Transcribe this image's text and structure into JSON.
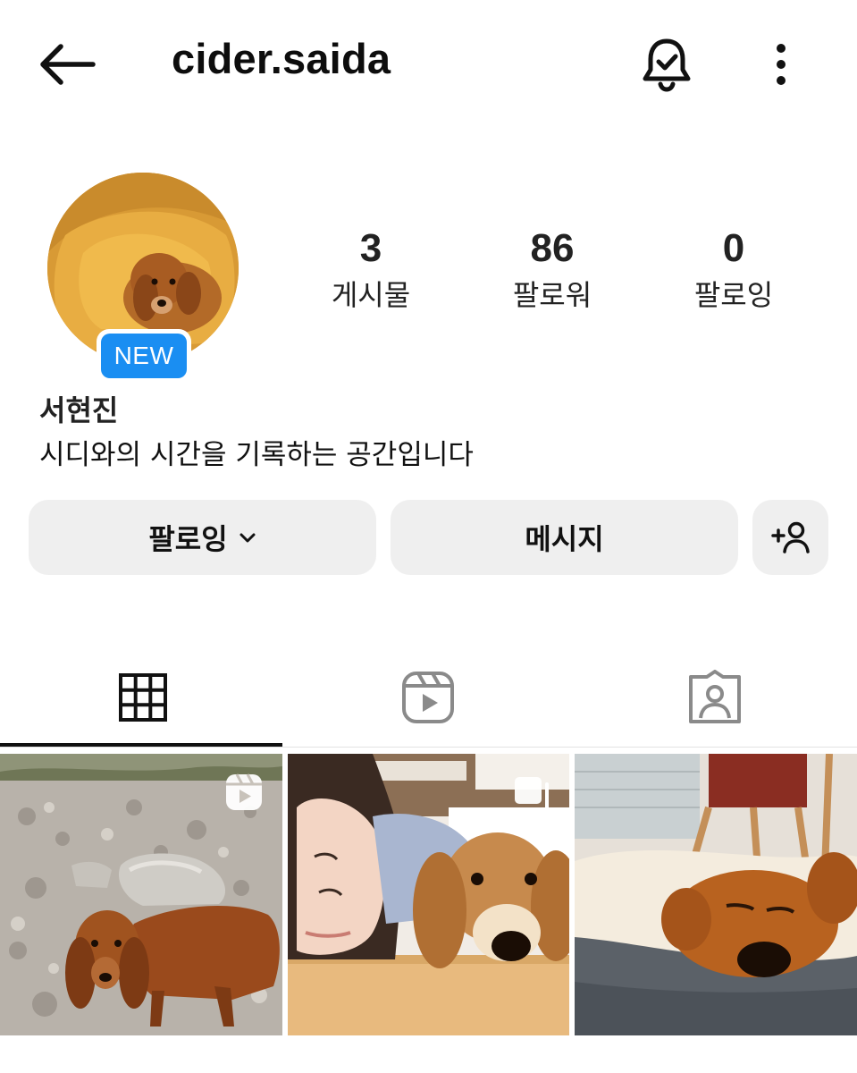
{
  "header": {
    "username": "cider.saida",
    "back_icon": "arrow-left-icon",
    "bell_icon": "bell-check-icon",
    "more_icon": "more-vertical-icon"
  },
  "profile": {
    "avatar": "profile-photo-dog-on-beanbag",
    "badge": "NEW",
    "stats": [
      {
        "value": "3",
        "label": "게시물"
      },
      {
        "value": "86",
        "label": "팔로워"
      },
      {
        "value": "0",
        "label": "팔로잉"
      }
    ],
    "display_name": "서현진",
    "bio": "시디와의 시간을 기록하는 공간입니다"
  },
  "actions": {
    "following_label": "팔로잉",
    "message_label": "메시지",
    "add_user_icon": "add-person-icon"
  },
  "tabs": [
    {
      "icon": "grid-icon",
      "active": true
    },
    {
      "icon": "reels-icon",
      "active": false
    },
    {
      "icon": "tagged-icon",
      "active": false
    }
  ],
  "posts": [
    {
      "type": "reel",
      "icon": "reel-overlay-icon",
      "image": "dachshund-on-gravel"
    },
    {
      "type": "carousel",
      "icon": "carousel-overlay-icon",
      "image": "woman-and-dachshund-on-floor"
    },
    {
      "type": "photo",
      "image": "dachshund-in-bed"
    }
  ],
  "colors": {
    "accent": "#1a8ef2",
    "button_bg": "#efefef",
    "text": "#111111"
  }
}
